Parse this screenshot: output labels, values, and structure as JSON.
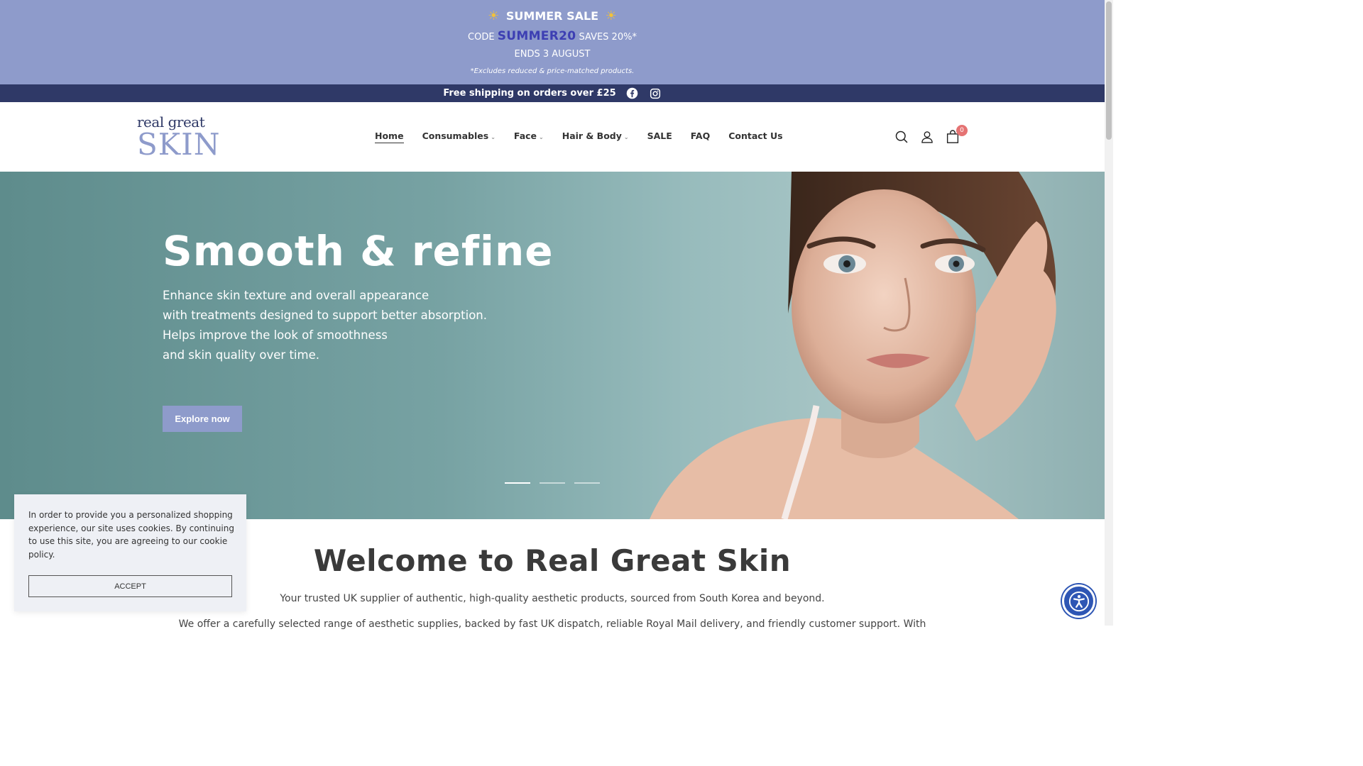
{
  "promo": {
    "title": "SUMMER SALE",
    "sun_glyph": "☀",
    "code_prefix": "CODE",
    "code": "SUMMER20",
    "code_suffix": "SAVES 20%*",
    "ends": "ENDS 3 AUGUST",
    "note": "*Excludes reduced & price-matched products.",
    "bg_color": "#8e9bcb",
    "code_color": "#3d3fb3"
  },
  "shipping": {
    "text": "Free shipping on orders over £25",
    "icons": [
      "facebook-icon",
      "instagram-icon"
    ],
    "bg_color": "#2f3967"
  },
  "logo": {
    "top": "real great",
    "bottom": "SKIN"
  },
  "nav": {
    "items": [
      {
        "label": "Home",
        "dropdown": false,
        "active": true
      },
      {
        "label": "Consumables",
        "dropdown": true
      },
      {
        "label": "Face",
        "dropdown": true
      },
      {
        "label": "Hair & Body",
        "dropdown": true
      },
      {
        "label": "SALE",
        "dropdown": false
      },
      {
        "label": "FAQ",
        "dropdown": false
      },
      {
        "label": "Contact Us",
        "dropdown": false
      }
    ],
    "caret": "⌄"
  },
  "header_icons": {
    "cart_count": "0"
  },
  "hero": {
    "heading": "Smooth & refine",
    "lines": [
      "Enhance skin texture and overall appearance",
      "with treatments designed to support better absorption.",
      "Helps improve the look of smoothness",
      "and skin quality over time."
    ],
    "cta": "Explore now",
    "slides": 3,
    "active_slide": 1
  },
  "welcome": {
    "title": "Welcome to Real Great Skin",
    "subtitle": "Your trusted UK supplier of authentic, high-quality aesthetic products, sourced from South Korea and beyond.",
    "more": "We offer a carefully selected range of aesthetic supplies, backed by fast UK dispatch, reliable Royal Mail delivery, and friendly customer support. With"
  },
  "cookie": {
    "text": "In order to provide you a personalized shopping experience, our site uses cookies. By continuing to use this site, you are agreeing to our cookie policy.",
    "accept": "ACCEPT"
  }
}
